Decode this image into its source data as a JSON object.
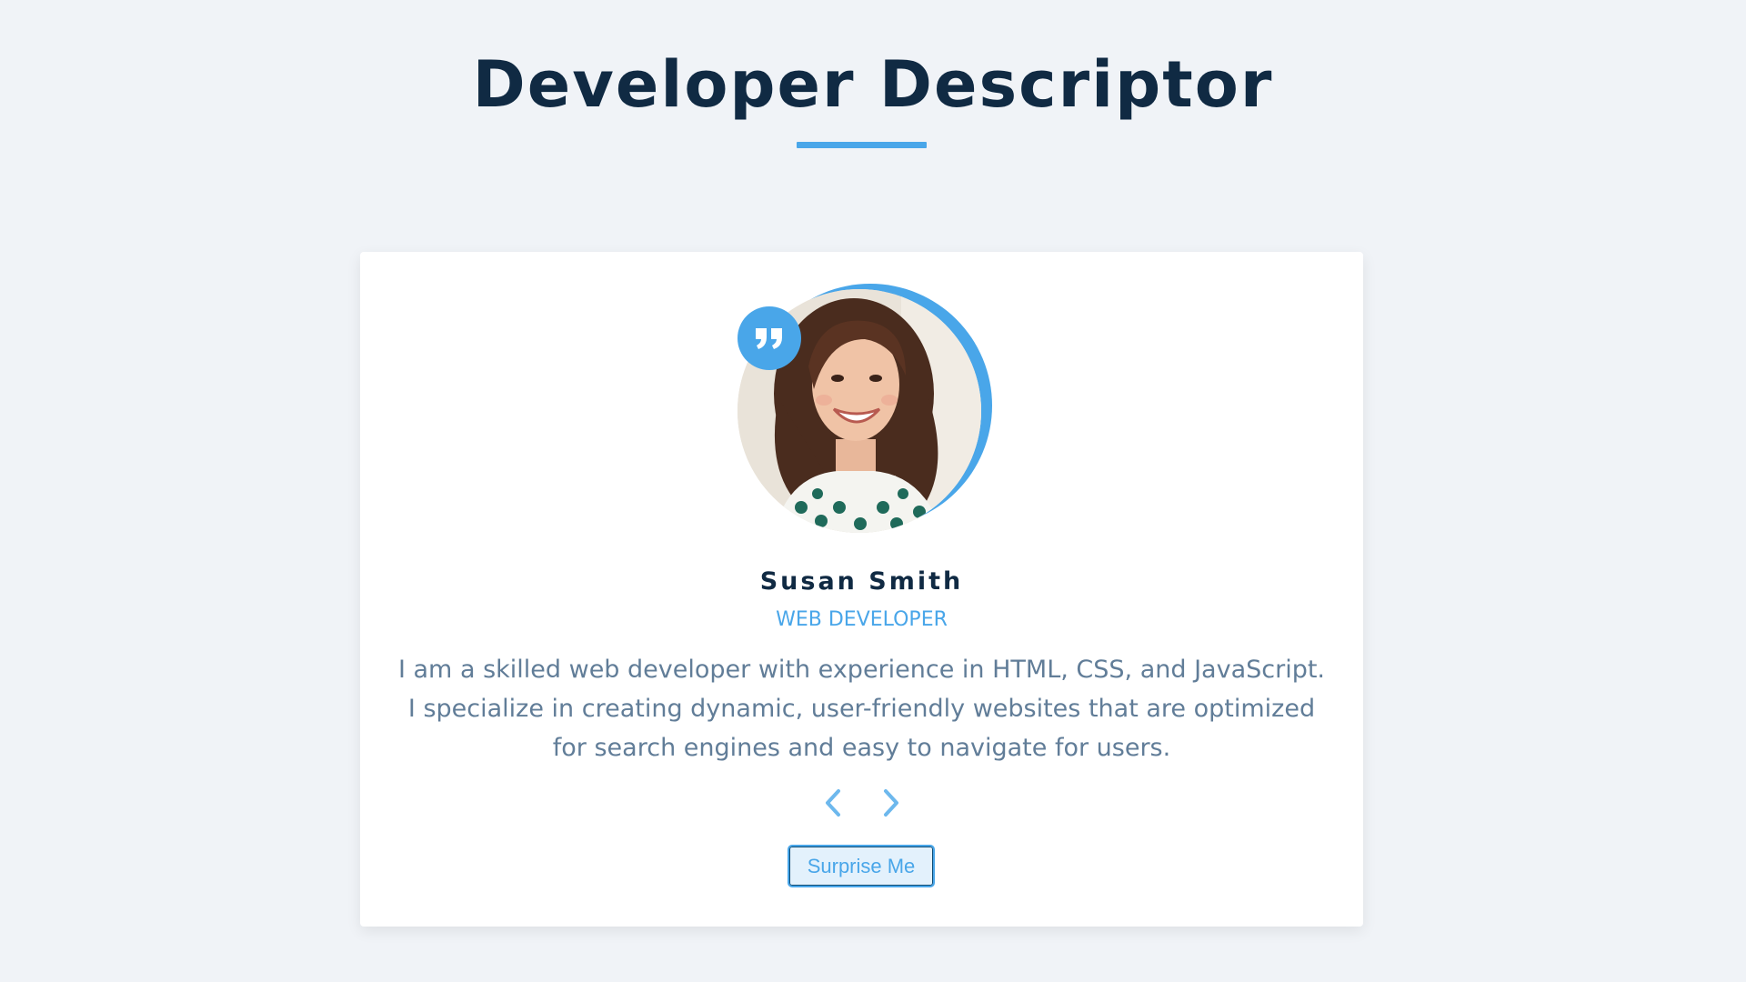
{
  "header": {
    "title": "Developer Descriptor"
  },
  "review": {
    "name": "Susan Smith",
    "job": "WEB DEVELOPER",
    "info_lines": [
      "I am a skilled web developer with experience in HTML, CSS, and JavaScript.",
      "I specialize in creating dynamic, user-friendly websites that are optimized",
      "for search engines and easy to navigate for users."
    ],
    "avatar_icon": "person-photo",
    "quote_icon": "quote-icon"
  },
  "controls": {
    "prev_icon": "chevron-left-icon",
    "next_icon": "chevron-right-icon",
    "random_label": "Surprise Me"
  },
  "colors": {
    "background": "#f0f3f7",
    "accent": "#49a6e9",
    "title": "#102a43",
    "text": "#617d98",
    "card": "#ffffff"
  }
}
